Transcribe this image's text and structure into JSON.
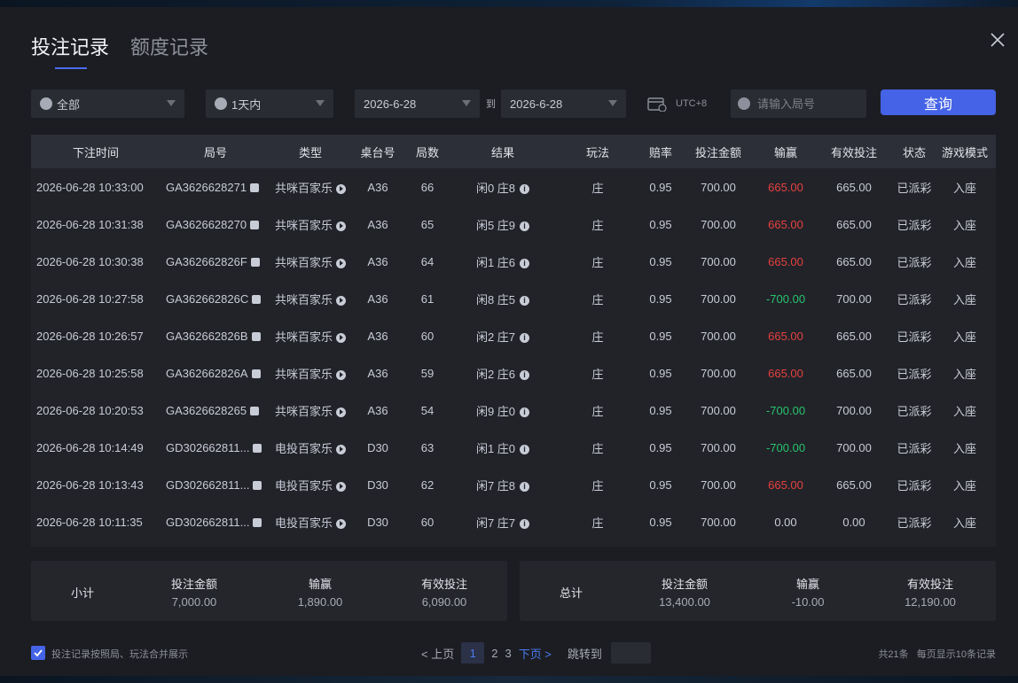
{
  "tabs": [
    {
      "label": "投注记录",
      "active": true
    },
    {
      "label": "额度记录",
      "active": false
    }
  ],
  "filters": {
    "type_select": "全部",
    "time_select": "1天内",
    "date_from": "2026-6-28",
    "to_label": "到",
    "date_to": "2026-6-28",
    "timezone": "UTC+8",
    "round_placeholder": "请输入局号",
    "search_label": "查询"
  },
  "table": {
    "headers": [
      "下注时间",
      "局号",
      "类型",
      "桌台号",
      "局数",
      "结果",
      "玩法",
      "赔率",
      "投注金额",
      "输赢",
      "有效投注",
      "状态",
      "游戏模式"
    ],
    "rows": [
      {
        "time": "2026-06-28 10:33:00",
        "round": "GA3626628271",
        "type": "共咪百家乐",
        "table": "A36",
        "num": "66",
        "result": "闲0 庄8",
        "play": "庄",
        "odds": "0.95",
        "bet": "700.00",
        "win": "665.00",
        "win_color": "red",
        "valid": "665.00",
        "status": "已派彩",
        "mode": "入座"
      },
      {
        "time": "2026-06-28 10:31:38",
        "round": "GA3626628270",
        "type": "共咪百家乐",
        "table": "A36",
        "num": "65",
        "result": "闲5 庄9",
        "play": "庄",
        "odds": "0.95",
        "bet": "700.00",
        "win": "665.00",
        "win_color": "red",
        "valid": "665.00",
        "status": "已派彩",
        "mode": "入座"
      },
      {
        "time": "2026-06-28 10:30:38",
        "round": "GA362662826F",
        "type": "共咪百家乐",
        "table": "A36",
        "num": "64",
        "result": "闲1 庄6",
        "play": "庄",
        "odds": "0.95",
        "bet": "700.00",
        "win": "665.00",
        "win_color": "red",
        "valid": "665.00",
        "status": "已派彩",
        "mode": "入座"
      },
      {
        "time": "2026-06-28 10:27:58",
        "round": "GA362662826C",
        "type": "共咪百家乐",
        "table": "A36",
        "num": "61",
        "result": "闲8 庄5",
        "play": "庄",
        "odds": "0.95",
        "bet": "700.00",
        "win": "-700.00",
        "win_color": "green",
        "valid": "700.00",
        "status": "已派彩",
        "mode": "入座"
      },
      {
        "time": "2026-06-28 10:26:57",
        "round": "GA362662826B",
        "type": "共咪百家乐",
        "table": "A36",
        "num": "60",
        "result": "闲2 庄7",
        "play": "庄",
        "odds": "0.95",
        "bet": "700.00",
        "win": "665.00",
        "win_color": "red",
        "valid": "665.00",
        "status": "已派彩",
        "mode": "入座"
      },
      {
        "time": "2026-06-28 10:25:58",
        "round": "GA362662826A",
        "type": "共咪百家乐",
        "table": "A36",
        "num": "59",
        "result": "闲2 庄6",
        "play": "庄",
        "odds": "0.95",
        "bet": "700.00",
        "win": "665.00",
        "win_color": "red",
        "valid": "665.00",
        "status": "已派彩",
        "mode": "入座"
      },
      {
        "time": "2026-06-28 10:20:53",
        "round": "GA3626628265",
        "type": "共咪百家乐",
        "table": "A36",
        "num": "54",
        "result": "闲9 庄0",
        "play": "庄",
        "odds": "0.95",
        "bet": "700.00",
        "win": "-700.00",
        "win_color": "green",
        "valid": "700.00",
        "status": "已派彩",
        "mode": "入座"
      },
      {
        "time": "2026-06-28 10:14:49",
        "round": "GD302662811...",
        "type": "电投百家乐",
        "table": "D30",
        "num": "63",
        "result": "闲1 庄0",
        "play": "庄",
        "odds": "0.95",
        "bet": "700.00",
        "win": "-700.00",
        "win_color": "green",
        "valid": "700.00",
        "status": "已派彩",
        "mode": "入座"
      },
      {
        "time": "2026-06-28 10:13:43",
        "round": "GD302662811...",
        "type": "电投百家乐",
        "table": "D30",
        "num": "62",
        "result": "闲7 庄8",
        "play": "庄",
        "odds": "0.95",
        "bet": "700.00",
        "win": "665.00",
        "win_color": "red",
        "valid": "665.00",
        "status": "已派彩",
        "mode": "入座"
      },
      {
        "time": "2026-06-28 10:11:35",
        "round": "GD302662811...",
        "type": "电投百家乐",
        "table": "D30",
        "num": "60",
        "result": "闲7 庄7",
        "play": "庄",
        "odds": "0.95",
        "bet": "700.00",
        "win": "0.00",
        "win_color": "normal",
        "valid": "0.00",
        "status": "已派彩",
        "mode": "入座"
      }
    ]
  },
  "subtotal": {
    "label": "小计",
    "bet_label": "投注金额",
    "bet": "7,000.00",
    "win_label": "输赢",
    "win": "1,890.00",
    "win_color": "red",
    "valid_label": "有效投注",
    "valid": "6,090.00"
  },
  "total": {
    "label": "总计",
    "bet_label": "投注金额",
    "bet": "13,400.00",
    "win_label": "输赢",
    "win": "-10.00",
    "win_color": "green",
    "valid_label": "有效投注",
    "valid": "12,190.00"
  },
  "footer": {
    "merge_label": "投注记录按照局、玩法合并展示",
    "merge_checked": true,
    "prev": "< 上页",
    "pages": [
      "1",
      "2",
      "3"
    ],
    "current_page": "1",
    "next": "下页 >",
    "jump_label": "跳转到",
    "total_count": "共21条",
    "per_page": "每页显示10条记录"
  },
  "colors": {
    "accent": "#4563e6",
    "win_red": "#e5413f",
    "lose_green": "#26c46c"
  }
}
